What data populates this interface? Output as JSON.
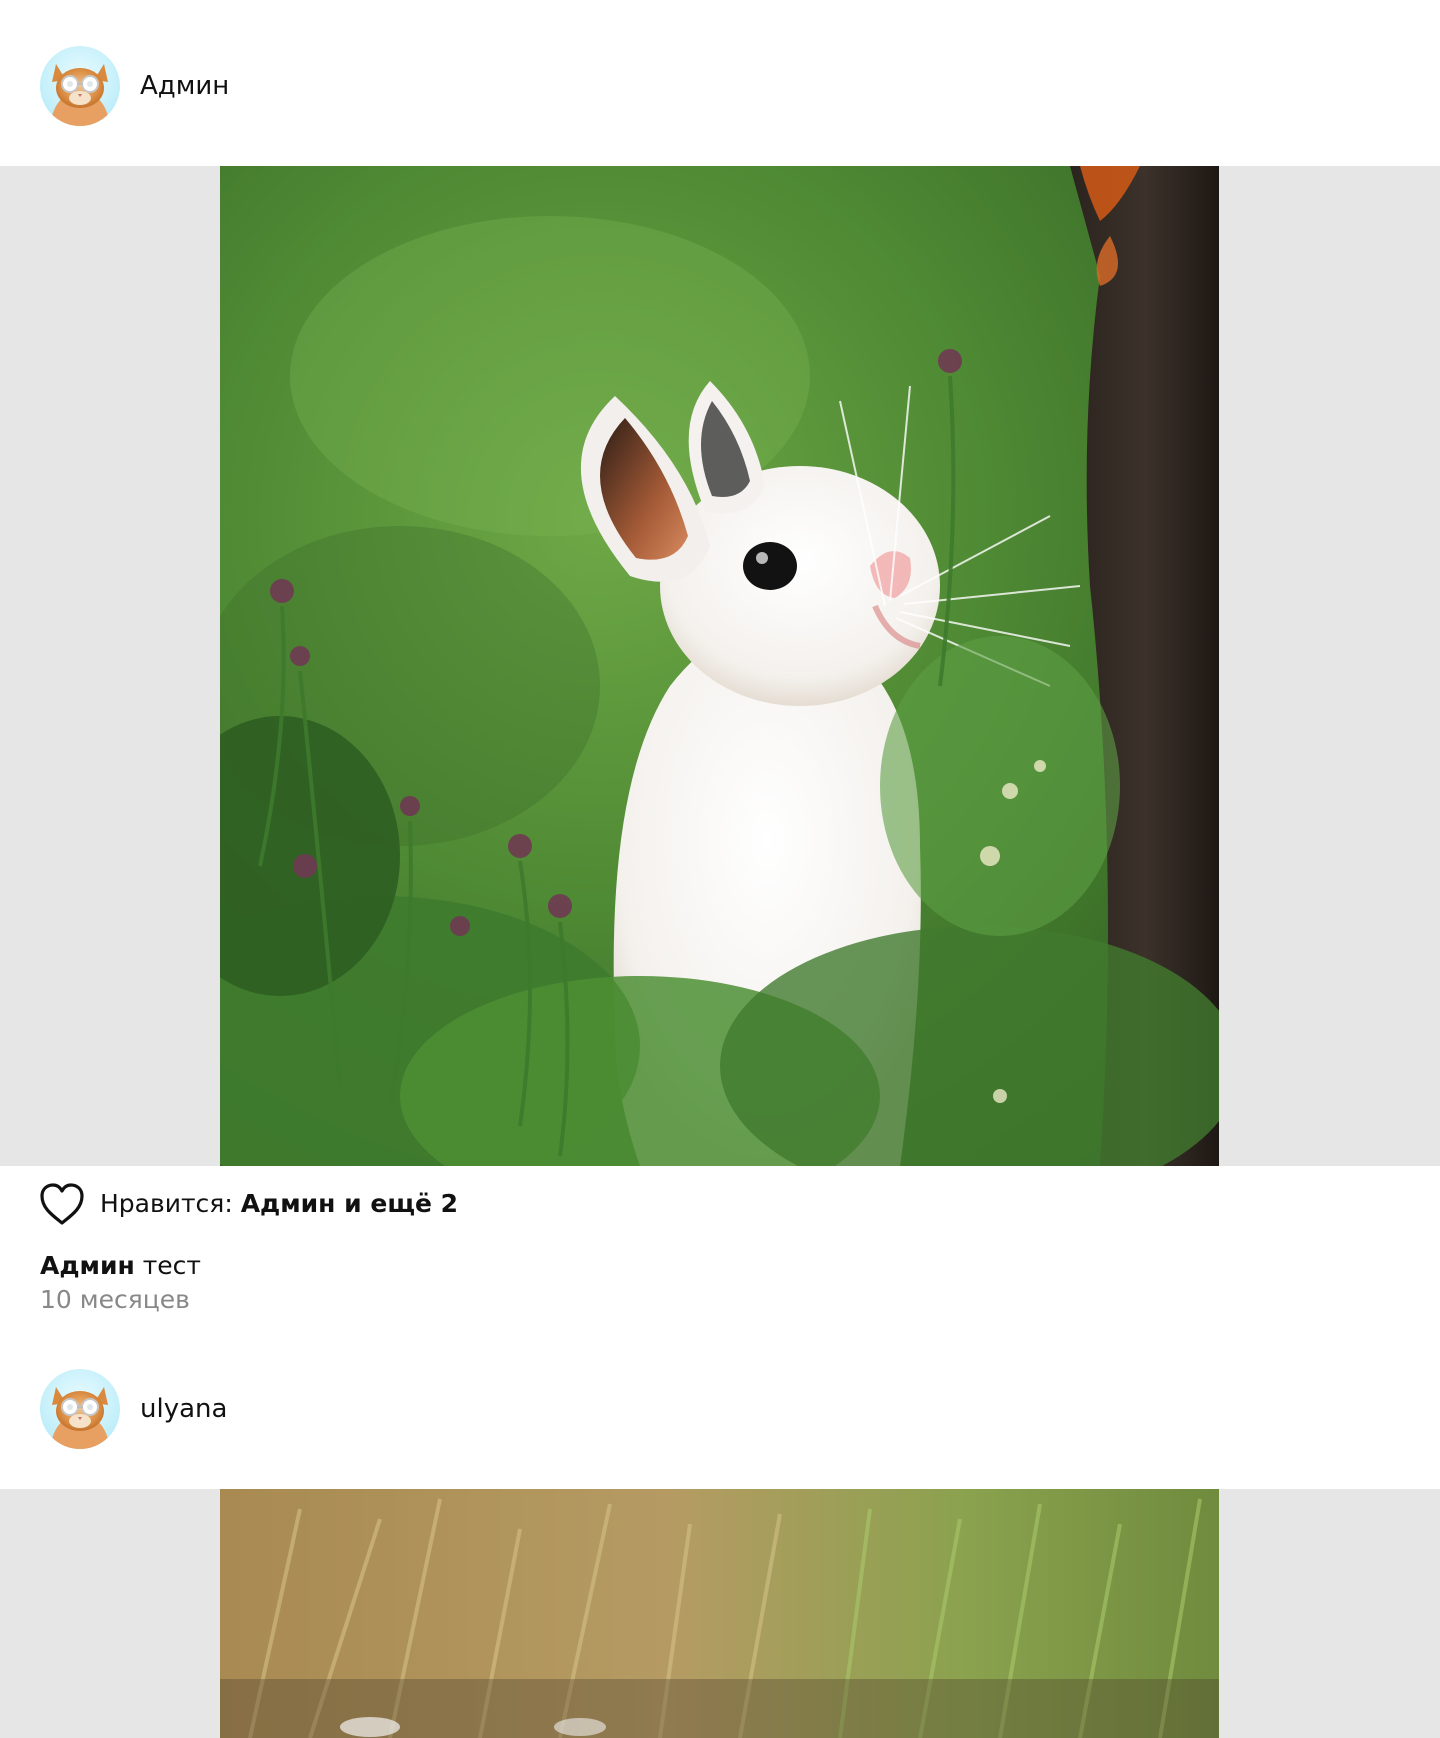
{
  "feed": {
    "posts": [
      {
        "separator": ",",
        "author": {
          "username": "Админ",
          "avatar_icon": "cat-with-glasses-avatar"
        },
        "image": {
          "subject": "white-bunny-in-grass"
        },
        "likes": {
          "heart_icon": "heart-outline-icon",
          "prefix": "Нравится: ",
          "summary": "Админ и ещё 2"
        },
        "caption": {
          "author": "Админ",
          "text": " тест"
        },
        "time": "10 месяцев"
      },
      {
        "separator": ",",
        "author": {
          "username": "ulyana",
          "avatar_icon": "cat-with-glasses-avatar"
        },
        "image": {
          "subject": "grass-field-photo"
        }
      }
    ]
  }
}
